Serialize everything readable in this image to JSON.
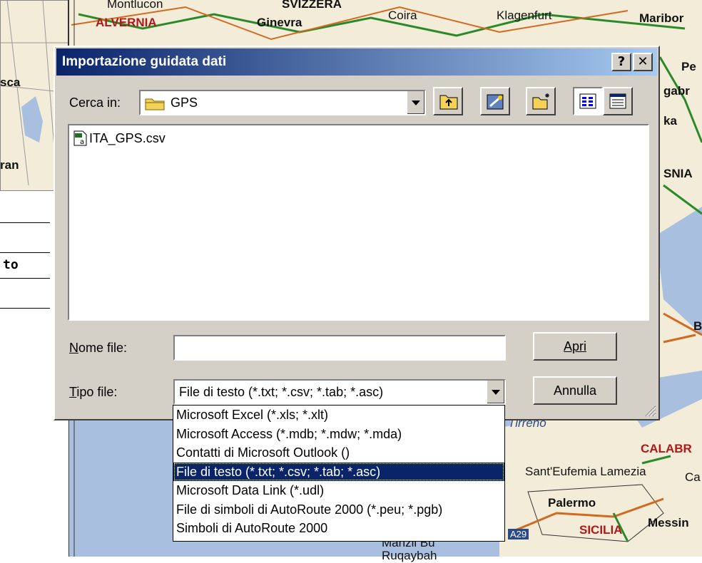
{
  "map": {
    "labels": [
      {
        "text": "Montlucon",
        "style": ""
      },
      {
        "text": "ALVERNIA",
        "style": "red"
      },
      {
        "text": "SVIZZERA",
        "style": "bold"
      },
      {
        "text": "Ginevra",
        "style": "bold"
      },
      {
        "text": "Coira",
        "style": ""
      },
      {
        "text": "Klagenfurt",
        "style": ""
      },
      {
        "text": "Maribor",
        "style": "bold"
      },
      {
        "text": "sca",
        "style": "bold"
      },
      {
        "text": "ran",
        "style": "bold"
      },
      {
        "text": "Pe",
        "style": "bold"
      },
      {
        "text": "gabr",
        "style": "bold"
      },
      {
        "text": "ka",
        "style": "bold"
      },
      {
        "text": "SNIA",
        "style": "bold"
      },
      {
        "text": "CALABR",
        "style": "red"
      },
      {
        "text": "Sant'Eufemia Lamezia",
        "style": ""
      },
      {
        "text": "Ca",
        "style": ""
      },
      {
        "text": "Palermo",
        "style": "bold"
      },
      {
        "text": "Messin",
        "style": "bold"
      },
      {
        "text": "SICILIA",
        "style": "red"
      },
      {
        "text": "Manzil Bu",
        "style": ""
      },
      {
        "text": "Ruqaybah",
        "style": ""
      },
      {
        "text": "Tirreno",
        "style": "blue"
      },
      {
        "text": "A29",
        "style": ""
      },
      {
        "text": "B",
        "style": "bold"
      }
    ]
  },
  "left_panel": {
    "text": "to"
  },
  "dialog": {
    "title": "Importazione guidata dati",
    "help_button": "?",
    "close_button": "✕",
    "look_in_label": "Cerca in:",
    "look_in_value": "GPS",
    "files": [
      {
        "name": "ITA_GPS.csv",
        "icon": "csv-file-icon"
      }
    ],
    "filename_label": "Nome file:",
    "filename_value": "",
    "filetype_label": "Tipo file:",
    "filetype_value": "File di testo (*.txt; *.csv; *.tab; *.asc)",
    "open_button": "Apri",
    "cancel_button": "Annulla",
    "filetype_options": [
      "Microsoft Excel (*.xls; *.xlt)",
      "Microsoft Access (*.mdb; *.mdw; *.mda)",
      "Contatti di Microsoft Outlook ()",
      "File di testo (*.txt; *.csv; *.tab; *.asc)",
      "Microsoft Data Link (*.udl)",
      "File di simboli di AutoRoute 2000 (*.peu; *.pgb)",
      "Simboli di AutoRoute 2000"
    ],
    "selected_option_index": 3
  },
  "colors": {
    "title_start": "#0a246a",
    "title_end": "#a6caf0",
    "dialog_face": "#d4d0c8",
    "selection": "#0a246a",
    "sea": "#a9bfe0",
    "land": "#f3ecd8"
  }
}
